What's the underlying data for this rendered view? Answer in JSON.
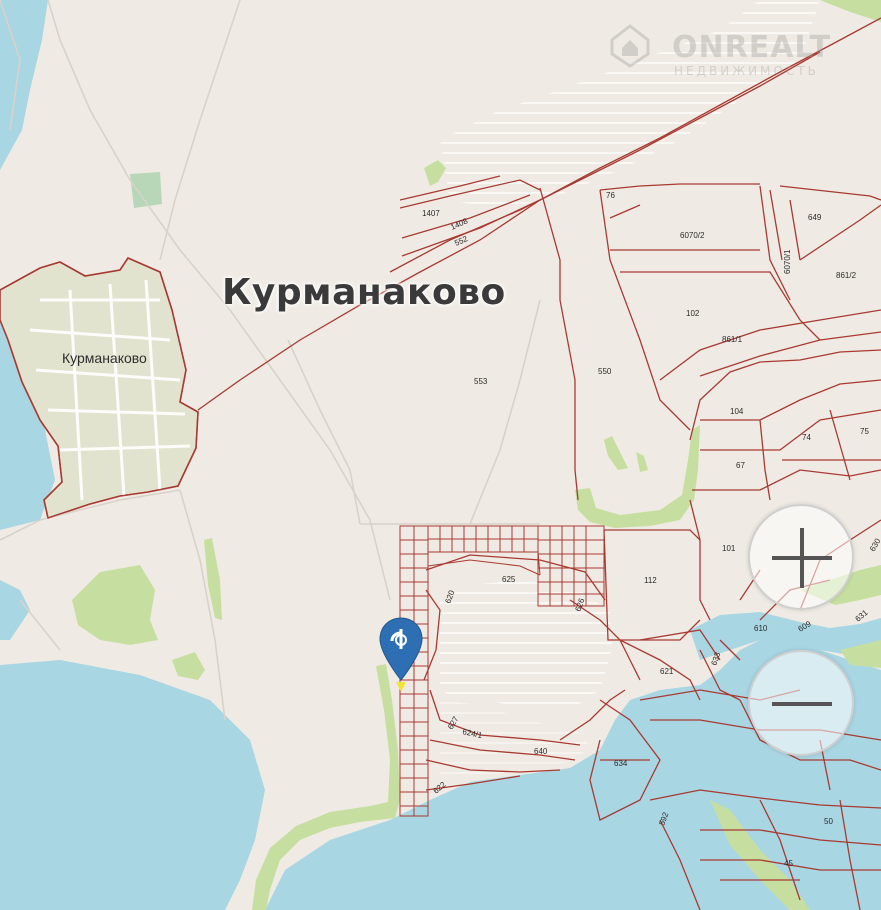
{
  "map": {
    "town_label_large": "Курманаково",
    "town_label_small": "Курманаково",
    "plot_labels": [
      "1407",
      "1408",
      "552",
      "76",
      "6070/2",
      "649",
      "6070/1",
      "861/2",
      "102",
      "861/1",
      "550",
      "553",
      "104",
      "74",
      "75",
      "67",
      "101",
      "112",
      "625",
      "620",
      "626",
      "610",
      "609",
      "630",
      "631",
      "621",
      "633",
      "627",
      "624/1",
      "640",
      "622",
      "634",
      "592",
      "50",
      "45"
    ]
  },
  "watermark": {
    "brand": "ONREALT",
    "subtitle": "НЕДВИЖИМОСТЬ"
  },
  "controls": {
    "zoom_in_icon": "plus-icon",
    "zoom_out_icon": "minus-icon"
  },
  "colors": {
    "land": "#efebe4",
    "water": "#a9d6e3",
    "green": "#c6dfa0",
    "boundary": "#a83a32",
    "pin": "#2e6fb3",
    "pin_point": "#f2e33a"
  }
}
